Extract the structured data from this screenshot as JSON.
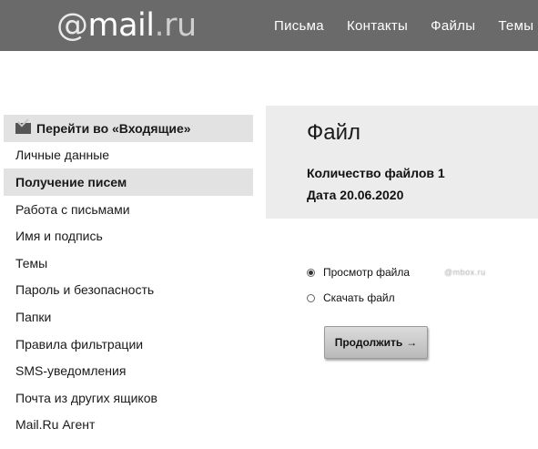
{
  "header": {
    "logo": {
      "at": "@",
      "mail": "mail",
      "dot": ".",
      "ru": "ru"
    },
    "nav": [
      "Письма",
      "Контакты",
      "Файлы",
      "Темы"
    ]
  },
  "sidebar": {
    "items": [
      {
        "label": "Перейти во «Входящие»",
        "icon": "envelope-icon",
        "highlighted": true
      },
      {
        "label": "Личные данные"
      },
      {
        "label": "Получение писем",
        "highlighted": true
      },
      {
        "label": "Работа с письмами"
      },
      {
        "label": "Имя и подпись"
      },
      {
        "label": "Темы"
      },
      {
        "label": "Пароль и безопасность"
      },
      {
        "label": "Папки"
      },
      {
        "label": "Правила фильтрации"
      },
      {
        "label": "SMS-уведомления"
      },
      {
        "label": "Почта из других ящиков"
      },
      {
        "label": "Mail.Ru Агент"
      }
    ]
  },
  "main": {
    "title": "Файл",
    "file_count": "Количество файлов  1",
    "date": "Дата 20.06.2020",
    "options": [
      {
        "label": "Просмотр файла",
        "checked": true
      },
      {
        "label": "Скачать файл",
        "checked": false
      }
    ],
    "watermark": "@mbox.ru",
    "continue_label": "Продолжить",
    "continue_arrow": "→"
  },
  "colors": {
    "header_bg": "#6a6a6a",
    "panel_bg": "#ececec",
    "highlight_bg": "#e2e2e2"
  }
}
